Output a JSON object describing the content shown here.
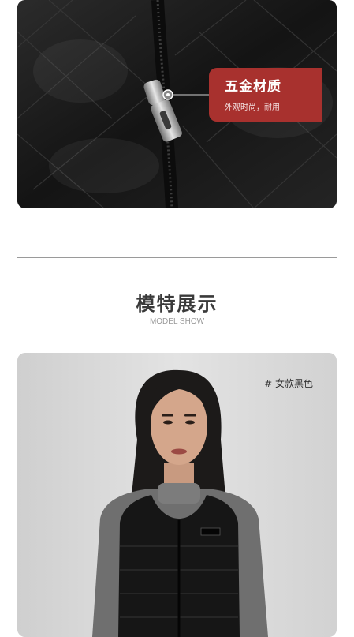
{
  "detail": {
    "callout_title": "五金材质",
    "callout_subtitle": "外观时尚，耐用",
    "accent_color": "#a8312e"
  },
  "section": {
    "title": "模特展示",
    "subtitle": "MODEL SHOW"
  },
  "model": {
    "tag": "# 女款黑色"
  },
  "icons": [
    "zipper-pull-icon",
    "callout-pointer-dot-icon",
    "vest-label-icon"
  ]
}
